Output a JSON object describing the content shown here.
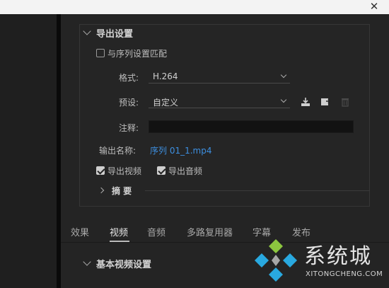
{
  "window": {
    "close_symbol": "✕"
  },
  "export_settings": {
    "title": "导出设置",
    "match_sequence_label": "与序列设置匹配",
    "match_sequence_checked": false,
    "format_label": "格式:",
    "format_value": "H.264",
    "preset_label": "预设:",
    "preset_value": "自定义",
    "comment_label": "注释:",
    "comment_value": "",
    "output_name_label": "输出名称:",
    "output_name_value": "序列 01_1.mp4",
    "export_video_label": "导出视频",
    "export_video_checked": true,
    "export_audio_label": "导出音频",
    "export_audio_checked": true,
    "summary_label": "摘 要"
  },
  "tabs": [
    {
      "label": "效果",
      "active": false
    },
    {
      "label": "视频",
      "active": true
    },
    {
      "label": "音频",
      "active": false
    },
    {
      "label": "多路复用器",
      "active": false
    },
    {
      "label": "字幕",
      "active": false
    },
    {
      "label": "发布",
      "active": false
    }
  ],
  "video_section": {
    "title": "基本视频设置"
  },
  "watermark": {
    "text": "系统城",
    "subtext": "XITONGCHENG.COM"
  },
  "colors": {
    "link": "#3d8fe0",
    "panel_bg": "#242424"
  },
  "icons": {
    "preset_save": "save-preset-icon",
    "preset_import": "import-preset-icon",
    "preset_delete": "trash-icon"
  }
}
